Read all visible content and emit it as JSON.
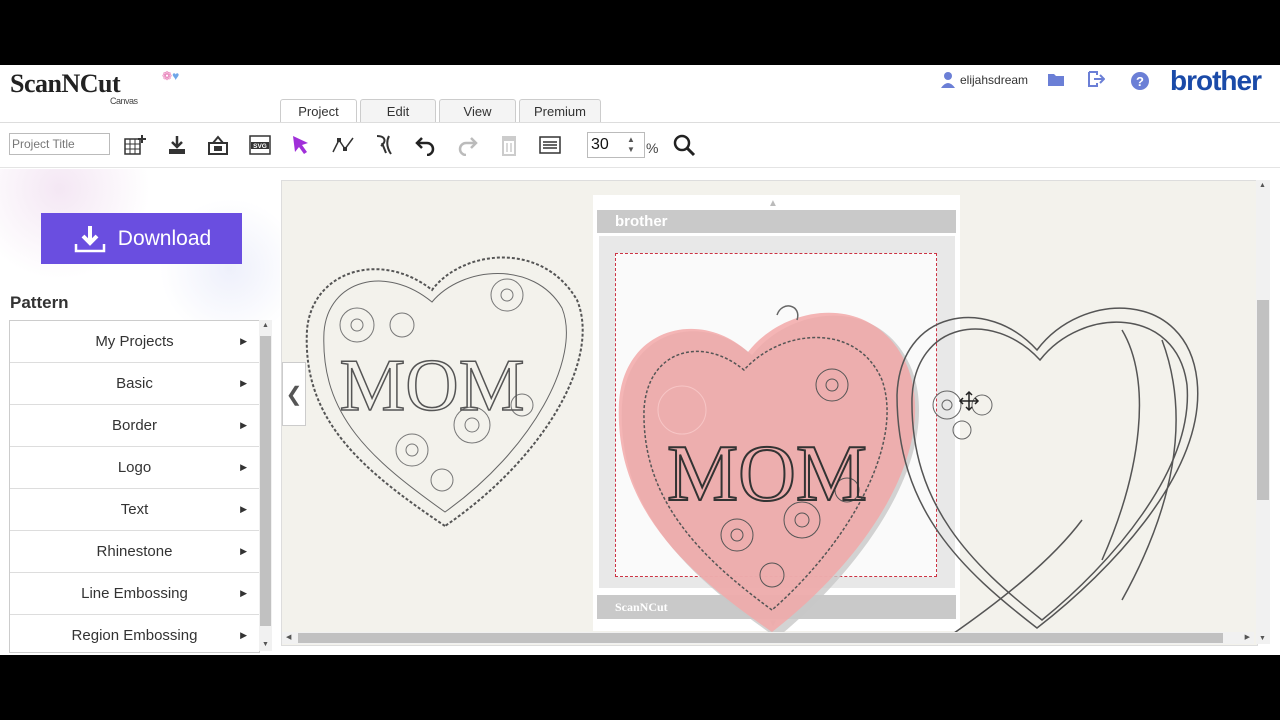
{
  "header": {
    "logo_text": "ScanNCut",
    "logo_sub": "Canvas",
    "username": "elijahsdream",
    "brand": "brother"
  },
  "tabs": [
    {
      "label": "Project",
      "active": true
    },
    {
      "label": "Edit",
      "active": false
    },
    {
      "label": "View",
      "active": false
    },
    {
      "label": "Premium",
      "active": false
    }
  ],
  "toolbar": {
    "project_title_placeholder": "Project Title",
    "zoom_value": "30",
    "zoom_unit": "%",
    "tools": [
      "new-project-icon",
      "save-icon",
      "import-icon",
      "svg-icon",
      "select-icon",
      "node-edit-icon",
      "curve-tool-icon",
      "undo-icon",
      "redo-icon",
      "delete-icon",
      "list-icon",
      "search-icon"
    ]
  },
  "sidebar": {
    "download_label": "Download",
    "pattern_title": "Pattern",
    "items": [
      {
        "label": "My Projects"
      },
      {
        "label": "Basic"
      },
      {
        "label": "Border"
      },
      {
        "label": "Logo"
      },
      {
        "label": "Text"
      },
      {
        "label": "Rhinestone"
      },
      {
        "label": "Line Embossing"
      },
      {
        "label": "Region Embossing"
      }
    ]
  },
  "canvas": {
    "mat_brand": "brother",
    "mat_footer": "ScanNCut",
    "design_text": "MOM"
  },
  "colors": {
    "accent": "#6a4ee0",
    "brand_blue": "#1a4aa8",
    "canvas_bg": "#f3f2ec",
    "heart_fill": "#f2a8a8"
  }
}
